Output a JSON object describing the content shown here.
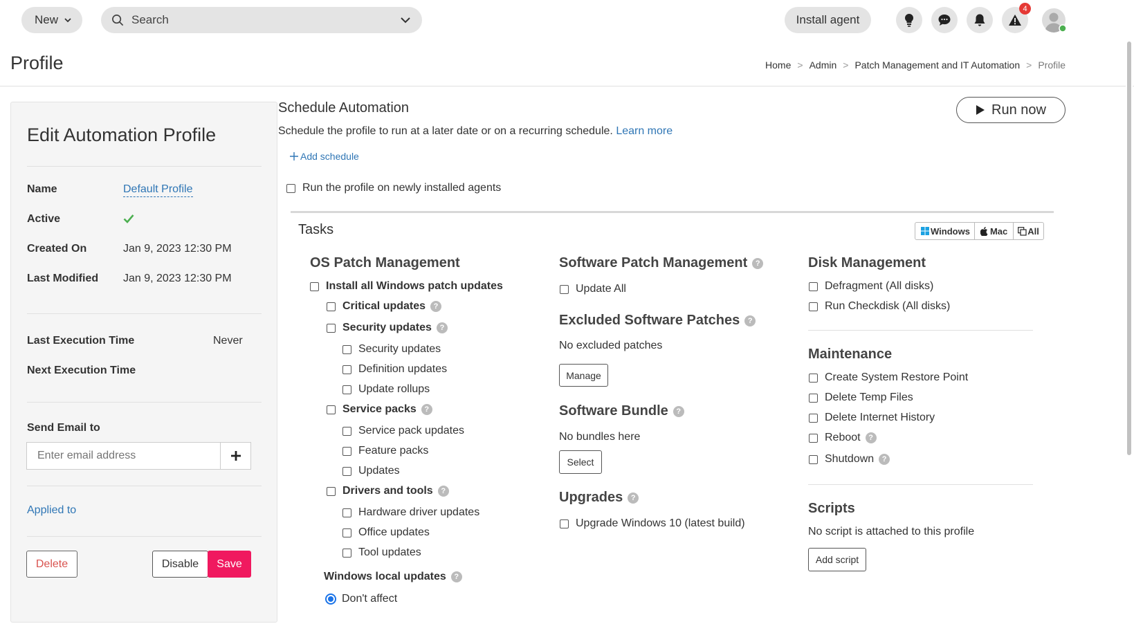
{
  "topbar": {
    "new_label": "New",
    "search_placeholder": "Search",
    "install_agent_label": "Install agent",
    "alert_count": "4"
  },
  "page": {
    "title": "Profile",
    "breadcrumb": [
      "Home",
      "Admin",
      "Patch Management and IT Automation",
      "Profile"
    ]
  },
  "profile_panel": {
    "heading": "Edit Automation Profile",
    "name_label": "Name",
    "name_value": "Default Profile",
    "active_label": "Active",
    "created_label": "Created On",
    "created_value": "Jan 9, 2023 12:30 PM",
    "modified_label": "Last Modified",
    "modified_value": "Jan 9, 2023 12:30 PM",
    "last_exec_label": "Last Execution Time",
    "last_exec_value": "Never",
    "next_exec_label": "Next Execution Time",
    "send_email_label": "Send Email to",
    "email_placeholder": "Enter email address",
    "applied_to_label": "Applied to",
    "delete_label": "Delete",
    "disable_label": "Disable",
    "save_label": "Save"
  },
  "schedule": {
    "title": "Schedule Automation",
    "description": "Schedule the profile to run at a later date or on a recurring schedule.",
    "learn_more": "Learn more",
    "add_schedule": "Add schedule",
    "run_new_agents": "Run the profile on newly installed agents",
    "run_now": "Run now"
  },
  "tasks": {
    "title": "Tasks",
    "os_filters": [
      "Windows",
      "Mac",
      "All"
    ],
    "os_patch": {
      "title": "OS Patch Management",
      "install_all": "Install all Windows patch updates",
      "critical": "Critical updates",
      "security": "Security updates",
      "security_items": [
        "Security updates",
        "Definition updates",
        "Update rollups"
      ],
      "service_packs": "Service packs",
      "service_items": [
        "Service pack updates",
        "Feature packs",
        "Updates"
      ],
      "drivers": "Drivers and tools",
      "driver_items": [
        "Hardware driver updates",
        "Office updates",
        "Tool updates"
      ],
      "local_updates": "Windows local updates",
      "dont_affect": "Don't affect"
    },
    "software_patch": {
      "title": "Software Patch Management",
      "update_all": "Update All",
      "excluded_title": "Excluded Software Patches",
      "excluded_text": "No excluded patches",
      "manage": "Manage",
      "bundle_title": "Software Bundle",
      "bundle_text": "No bundles here",
      "select": "Select",
      "upgrades_title": "Upgrades",
      "upgrade_win10": "Upgrade Windows 10 (latest build)"
    },
    "disk": {
      "title": "Disk Management",
      "defragment": "Defragment (All disks)",
      "checkdisk": "Run Checkdisk (All disks)"
    },
    "maintenance": {
      "title": "Maintenance",
      "items": [
        "Create System Restore Point",
        "Delete Temp Files",
        "Delete Internet History",
        "Reboot",
        "Shutdown"
      ]
    },
    "scripts": {
      "title": "Scripts",
      "text": "No script is attached to this profile",
      "add_script": "Add script"
    }
  }
}
